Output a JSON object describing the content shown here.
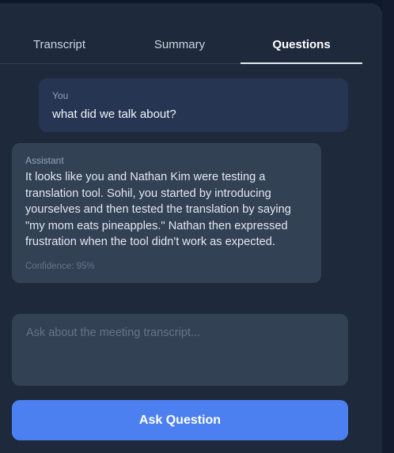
{
  "tabs": {
    "transcript": "Transcript",
    "summary": "Summary",
    "questions": "Questions",
    "active": "Questions"
  },
  "messages": {
    "user": {
      "role": "You",
      "text": "what did we talk about?"
    },
    "assistant": {
      "role": "Assistant",
      "text": "It looks like you and Nathan Kim were testing a translation tool. Sohil, you started by introducing yourselves and then tested the translation by saying \"my mom eats pineapples.\" Nathan then expressed frustration when the tool didn't work as expected.",
      "confidence": "Confidence: 95%"
    }
  },
  "input": {
    "placeholder": "Ask about the meeting transcript...",
    "value": ""
  },
  "ask_button": {
    "label": "Ask Question"
  },
  "colors": {
    "accent": "#4c80f1",
    "panel": "#1e293b",
    "user_bubble": "#263552",
    "assistant_bubble": "#334155"
  }
}
